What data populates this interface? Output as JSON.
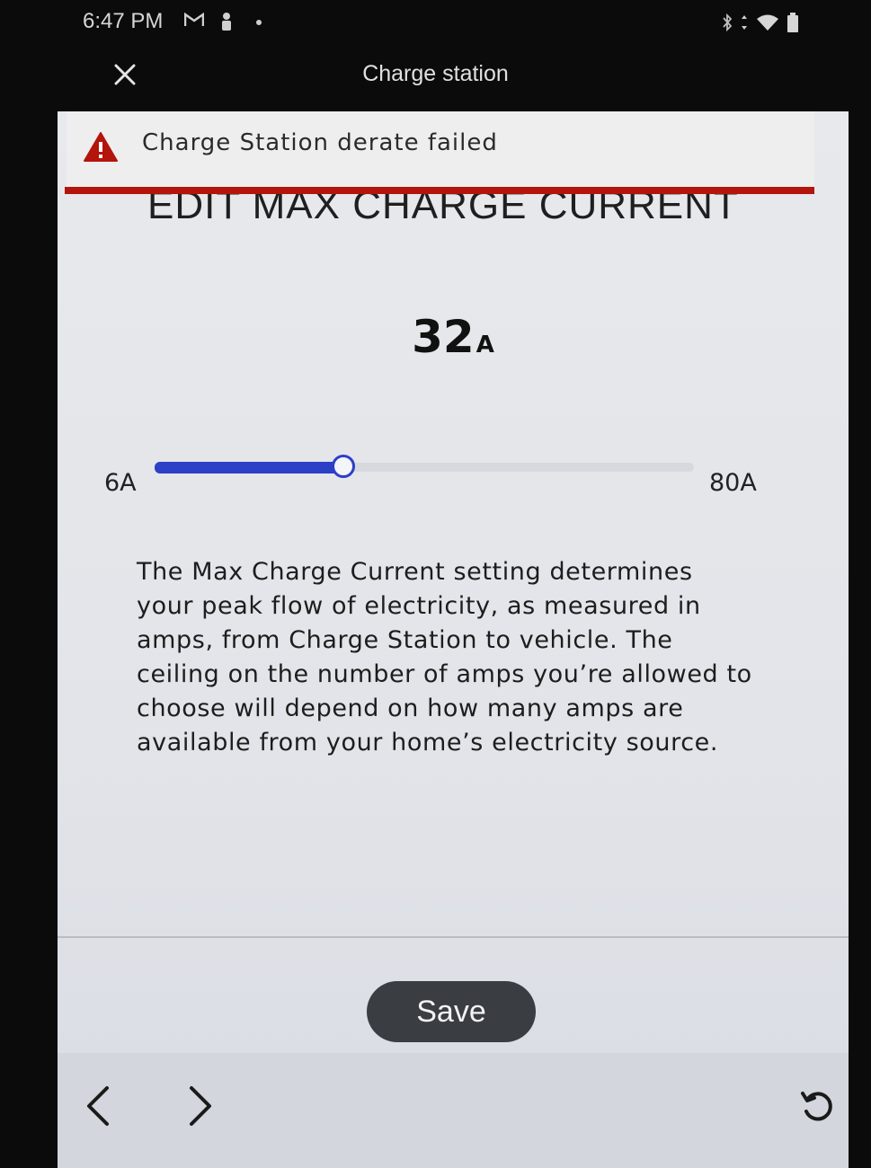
{
  "status_bar": {
    "time": "6:47 PM",
    "icons": [
      "gmail-icon",
      "person-icon",
      "dot-icon",
      "bluetooth-icon",
      "vibrate-icon",
      "wifi-icon",
      "battery-icon"
    ]
  },
  "titlebar": {
    "title": "Charge station",
    "close_icon": "close-icon"
  },
  "alert": {
    "icon": "warning-icon",
    "message": "Charge Station derate failed",
    "color": "#b3140c"
  },
  "heading": "EDIT MAX CHARGE CURRENT",
  "current": {
    "value": "32",
    "unit": "A"
  },
  "slider": {
    "min_label": "6A",
    "max_label": "80A",
    "min": 6,
    "max": 80,
    "value": 32,
    "accent_color": "#2c3fc7"
  },
  "description": "The Max Charge Current setting determines your peak flow of electricity, as measured in amps, from Charge Station to vehicle. The ceiling on the number of amps you’re allowed to choose will depend on how many amps are available from your home’s electricity source.",
  "save_label": "Save",
  "bottom_nav": {
    "back_icon": "chevron-left-icon",
    "forward_icon": "chevron-right-icon",
    "refresh_icon": "refresh-icon"
  }
}
